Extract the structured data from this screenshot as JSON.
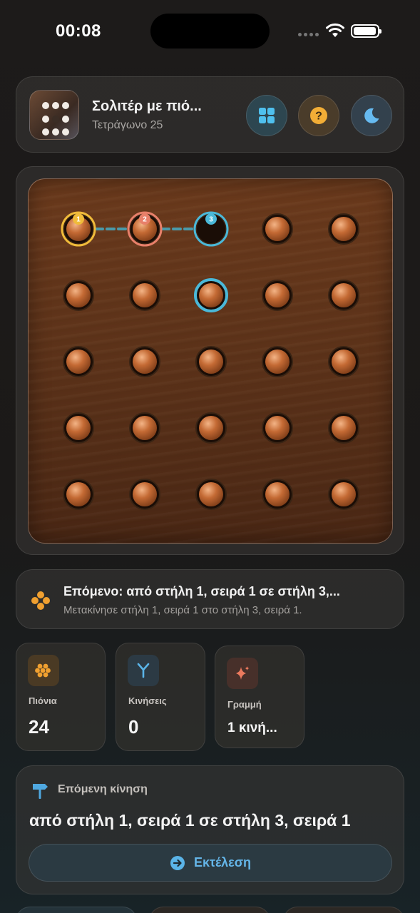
{
  "status_bar": {
    "time": "00:08"
  },
  "header": {
    "title": "Σολιτέρ με πιό...",
    "subtitle": "Τετράγωνο 25",
    "buttons": [
      "grid-icon",
      "help-icon",
      "moon-icon"
    ]
  },
  "board": {
    "rows": 5,
    "cols": 5,
    "peg_color": "#c46a34",
    "cells": [
      [
        1,
        1,
        0,
        1,
        1
      ],
      [
        1,
        1,
        1,
        1,
        1
      ],
      [
        1,
        1,
        1,
        1,
        1
      ],
      [
        1,
        1,
        1,
        1,
        1
      ],
      [
        1,
        1,
        1,
        1,
        1
      ]
    ],
    "path_markers": [
      {
        "row": 0,
        "col": 0,
        "label": "1",
        "color": "#f0bb3a"
      },
      {
        "row": 0,
        "col": 1,
        "label": "2",
        "color": "#e8806a"
      },
      {
        "row": 0,
        "col": 2,
        "label": "3",
        "color": "#4ab8d8"
      }
    ],
    "highlight_cell": {
      "row": 1,
      "col": 2,
      "color": "#4ab8d8"
    },
    "connector_color": "#4a9aaa"
  },
  "hint": {
    "title": "Επόμενο: από στήλη 1, σειρά 1 σε στήλη 3,...",
    "subtitle": "Μετακίνησε στήλη 1, σειρά 1 στο στήλη 3, σειρά 1.",
    "icon": "pegs-icon"
  },
  "stats": [
    {
      "label": "Πιόνια",
      "value": "24",
      "icon": "hive-icon",
      "color": "#f0a030"
    },
    {
      "label": "Κινήσεις",
      "value": "0",
      "icon": "fork-icon",
      "color": "#5ab4e8"
    },
    {
      "label": "Γραμμή",
      "value": "1 κινή...",
      "icon": "sparkle-icon",
      "color": "#e8705a"
    }
  ],
  "next_move": {
    "label": "Επόμενη κίνηση",
    "move": "από στήλη 1, σειρά 1 σε στήλη 3, σειρά 1",
    "execute_label": "Εκτέλεση"
  }
}
